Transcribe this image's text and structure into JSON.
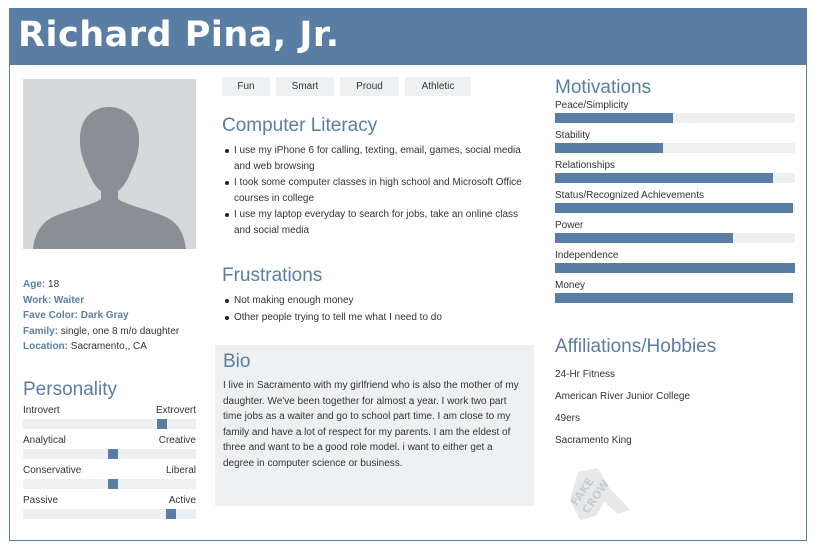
{
  "persona": {
    "name": "Richard Pina, Jr."
  },
  "facts": [
    {
      "key": "Age:",
      "value": " 18"
    },
    {
      "key": "Work: Waiter",
      "value": ""
    },
    {
      "key": "Fave Color: Dark Gray",
      "value": ""
    },
    {
      "key": "Family:",
      "value": " single, one 8 m/o daughter"
    },
    {
      "key": "Location:",
      "value": " Sacramento,, CA"
    }
  ],
  "personality": {
    "title": "Personality",
    "traits": [
      {
        "left": "Introvert",
        "right": "Extrovert",
        "level": 0.82
      },
      {
        "left": "Analytical",
        "right": "Creative",
        "level": 0.52
      },
      {
        "left": "Conservative",
        "right": "Liberal",
        "level": 0.52
      },
      {
        "left": "Passive",
        "right": "Active",
        "level": 0.88
      }
    ]
  },
  "tags": [
    "Fun",
    "Smart",
    "Proud",
    "Athletic"
  ],
  "computer_literacy": {
    "title": "Computer Literacy",
    "items": [
      "I use my iPhone 6 for calling, texting, email, games, social media and web browsing",
      "I took some computer classes in high school and  Microsoft Office courses in college",
      "I use my laptop everyday to search for jobs, take an online class and social media"
    ]
  },
  "frustrations": {
    "title": "Frustrations",
    "items": [
      "Not making enough money",
      "Other people trying to tell me what I need to do"
    ]
  },
  "bio": {
    "title": "Bio",
    "text": "I live in Sacramento with my girlfriend who is also the mother of my daughter. We've been together for almost a year. I work two part time jobs as a waiter and go to school part time. I am close to my family and have a lot of respect for my parents. I am the eldest of three and want to be a good role model. i want to either get a degree in computer science or business."
  },
  "motivations": {
    "title": "Motivations",
    "items": [
      {
        "label": "Peace/Simplicity",
        "level": 0.49
      },
      {
        "label": "Stability",
        "level": 0.45
      },
      {
        "label": "Relationships",
        "level": 0.91
      },
      {
        "label": "Status/Recognized Achievements",
        "level": 0.99
      },
      {
        "label": "Power",
        "level": 0.74
      },
      {
        "label": "Independence",
        "level": 1.0
      },
      {
        "label": "Money",
        "level": 0.99
      }
    ]
  },
  "affiliations": {
    "title": "Affiliations/Hobbies",
    "items": [
      "24-Hr Fitness",
      "American River Junior College",
      "49ers",
      "Sacramento King"
    ]
  },
  "logo": {
    "line1": "FAKE",
    "line2": "CROW"
  },
  "colors": {
    "accent": "#5a7ea3",
    "panel": "#eef0f2"
  }
}
